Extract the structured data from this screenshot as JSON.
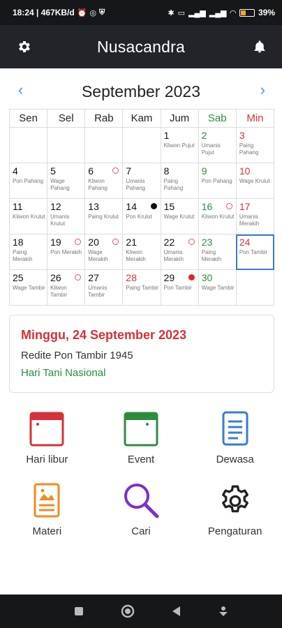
{
  "status_bar": {
    "time_net": "18:24 | 467KB/d",
    "battery": "39%"
  },
  "app_bar": {
    "title": "Nusacandra"
  },
  "calendar": {
    "month_title": "September 2023",
    "weekdays": [
      "Sen",
      "Sel",
      "Rab",
      "Kam",
      "Jum",
      "Sab",
      "Min"
    ],
    "weeks": [
      [
        {
          "day": "",
          "pasaran": ""
        },
        {
          "day": "",
          "pasaran": ""
        },
        {
          "day": "",
          "pasaran": ""
        },
        {
          "day": "",
          "pasaran": ""
        },
        {
          "day": "1",
          "pasaran": "Kliwon Pujut"
        },
        {
          "day": "2",
          "pasaran": "Umanis Pujut"
        },
        {
          "day": "3",
          "pasaran": "Paing Pahang"
        }
      ],
      [
        {
          "day": "4",
          "pasaran": "Pon Pahang"
        },
        {
          "day": "5",
          "pasaran": "Wage Pahang"
        },
        {
          "day": "6",
          "pasaran": "Kliwon Pahang"
        },
        {
          "day": "7",
          "pasaran": "Umanis Pahang"
        },
        {
          "day": "8",
          "pasaran": "Paing Pahang"
        },
        {
          "day": "9",
          "pasaran": "Pon Pahang"
        },
        {
          "day": "10",
          "pasaran": "Wage Krulut"
        }
      ],
      [
        {
          "day": "11",
          "pasaran": "Kliwon Krulut"
        },
        {
          "day": "12",
          "pasaran": "Umanis Krulut"
        },
        {
          "day": "13",
          "pasaran": "Paing Krulut"
        },
        {
          "day": "14",
          "pasaran": "Pon Krulut"
        },
        {
          "day": "15",
          "pasaran": "Wage Krulut"
        },
        {
          "day": "16",
          "pasaran": "Kliwon Krulut"
        },
        {
          "day": "17",
          "pasaran": "Umanis Merakih"
        }
      ],
      [
        {
          "day": "18",
          "pasaran": "Paing Merakih"
        },
        {
          "day": "19",
          "pasaran": "Pon Merakih"
        },
        {
          "day": "20",
          "pasaran": "Wage Merakih"
        },
        {
          "day": "21",
          "pasaran": "Kliwon Merakih"
        },
        {
          "day": "22",
          "pasaran": "Umanis Merakih"
        },
        {
          "day": "23",
          "pasaran": "Paing Merakih"
        },
        {
          "day": "24",
          "pasaran": "Pon Tambir"
        }
      ],
      [
        {
          "day": "25",
          "pasaran": "Wage Tambir"
        },
        {
          "day": "26",
          "pasaran": "Kliwon Tambir"
        },
        {
          "day": "27",
          "pasaran": "Umanis Tambir"
        },
        {
          "day": "28",
          "pasaran": "Paing Tambir"
        },
        {
          "day": "29",
          "pasaran": "Pon Tambir"
        },
        {
          "day": "30",
          "pasaran": "Wage Tambir"
        },
        {
          "day": "",
          "pasaran": ""
        }
      ]
    ]
  },
  "detail": {
    "date_title": "Minggu, 24 September 2023",
    "javanese_date": "Redite Pon Tambir 1945",
    "holiday": "Hari Tani Nasional"
  },
  "menu": {
    "hari_libur": "Hari libur",
    "event": "Event",
    "dewasa": "Dewasa",
    "materi": "Materi",
    "cari": "Cari",
    "pengaturan": "Pengaturan"
  },
  "colors": {
    "red": "#d6303a",
    "green": "#2e8b3d",
    "blue": "#3a7bd5",
    "orange": "#f08a24",
    "purple": "#7b2fd0"
  }
}
